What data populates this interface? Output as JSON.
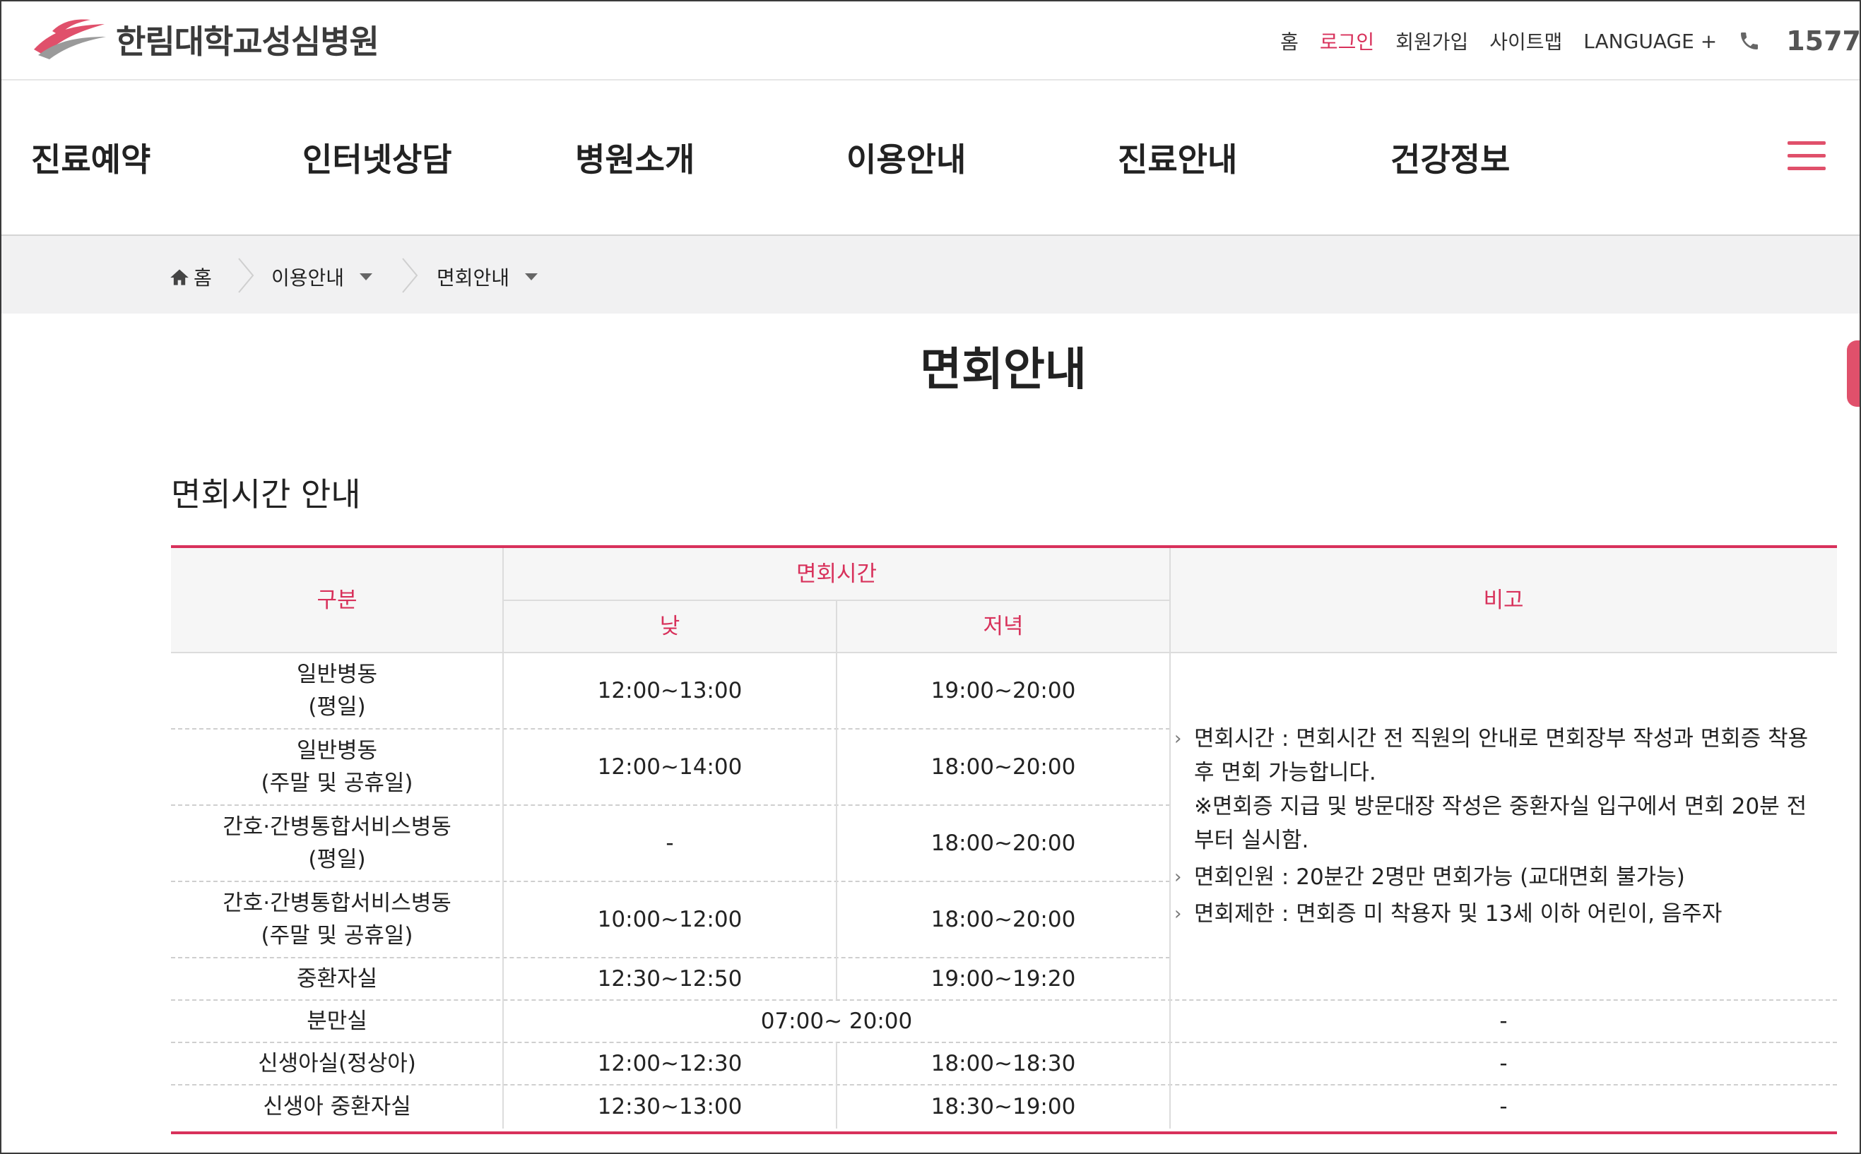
{
  "header": {
    "logo_text": "한림대학교성심병원",
    "util_links": [
      "홈",
      "로그인",
      "회원가입",
      "사이트맵",
      "LANGUAGE +"
    ],
    "phone": "1577"
  },
  "nav": {
    "items": [
      "진료예약",
      "인터넷상담",
      "병원소개",
      "이용안내",
      "진료안내",
      "건강정보"
    ]
  },
  "breadcrumb": {
    "home": "홈",
    "level1": "이용안내",
    "level2": "면회안내"
  },
  "page": {
    "title": "면회안내",
    "section_title": "면회시간 안내"
  },
  "table": {
    "headers": {
      "category": "구분",
      "visit_time": "면회시간",
      "day": "낮",
      "evening": "저녁",
      "remark": "비고"
    },
    "rows": [
      {
        "category": "일반병동\n(평일)",
        "day": "12:00~13:00",
        "evening": "19:00~20:00"
      },
      {
        "category": "일반병동\n(주말 및 공휴일)",
        "day": "12:00~14:00",
        "evening": "18:00~20:00"
      },
      {
        "category": "간호·간병통합서비스병동\n(평일)",
        "day": "-",
        "evening": "18:00~20:00"
      },
      {
        "category": "간호·간병통합서비스병동\n(주말 및 공휴일)",
        "day": "10:00~12:00",
        "evening": "18:00~20:00"
      },
      {
        "category": "중환자실",
        "day": "12:30~12:50",
        "evening": "19:00~19:20"
      },
      {
        "category": "분만실",
        "merged": "07:00~ 20:00",
        "remark": "-"
      },
      {
        "category": "신생아실(정상아)",
        "day": "12:00~12:30",
        "evening": "18:00~18:30",
        "remark": "-"
      },
      {
        "category": "신생아 중환자실",
        "day": "12:30~13:00",
        "evening": "18:30~19:00",
        "remark": "-"
      }
    ],
    "notes": [
      "면회시간 : 면회시간 전 직원의 안내로 면회장부 작성과 면회증 착용 후 면회 가능합니다.\n※면회증 지급 및 방문대장 작성은 중환자실 입구에서 면회 20분 전부터 실시함.",
      "면회인원 : 20분간 2명만 면회가능 (교대면회 불가능)",
      "면회제한 : 면회증 미 착용자 및 13세 이하 어린이, 음주자"
    ]
  },
  "colors": {
    "accent": "#d8315b",
    "header_bg": "#f6f6f6",
    "breadcrumb_bg": "#f1f1f2"
  }
}
